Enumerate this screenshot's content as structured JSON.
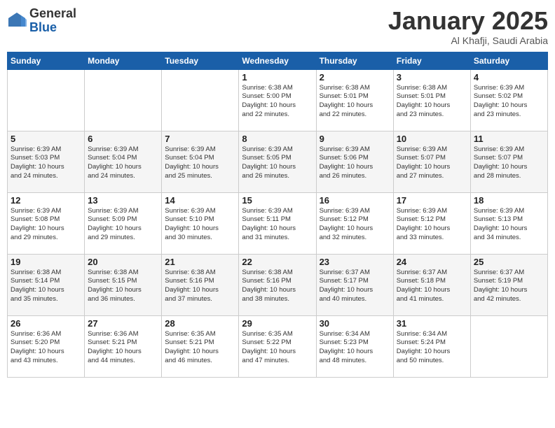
{
  "header": {
    "logo_general": "General",
    "logo_blue": "Blue",
    "month": "January 2025",
    "location": "Al Khafji, Saudi Arabia"
  },
  "days_of_week": [
    "Sunday",
    "Monday",
    "Tuesday",
    "Wednesday",
    "Thursday",
    "Friday",
    "Saturday"
  ],
  "weeks": [
    [
      {
        "day": "",
        "info": ""
      },
      {
        "day": "",
        "info": ""
      },
      {
        "day": "",
        "info": ""
      },
      {
        "day": "1",
        "info": "Sunrise: 6:38 AM\nSunset: 5:00 PM\nDaylight: 10 hours\nand 22 minutes."
      },
      {
        "day": "2",
        "info": "Sunrise: 6:38 AM\nSunset: 5:01 PM\nDaylight: 10 hours\nand 22 minutes."
      },
      {
        "day": "3",
        "info": "Sunrise: 6:38 AM\nSunset: 5:01 PM\nDaylight: 10 hours\nand 23 minutes."
      },
      {
        "day": "4",
        "info": "Sunrise: 6:39 AM\nSunset: 5:02 PM\nDaylight: 10 hours\nand 23 minutes."
      }
    ],
    [
      {
        "day": "5",
        "info": "Sunrise: 6:39 AM\nSunset: 5:03 PM\nDaylight: 10 hours\nand 24 minutes."
      },
      {
        "day": "6",
        "info": "Sunrise: 6:39 AM\nSunset: 5:04 PM\nDaylight: 10 hours\nand 24 minutes."
      },
      {
        "day": "7",
        "info": "Sunrise: 6:39 AM\nSunset: 5:04 PM\nDaylight: 10 hours\nand 25 minutes."
      },
      {
        "day": "8",
        "info": "Sunrise: 6:39 AM\nSunset: 5:05 PM\nDaylight: 10 hours\nand 26 minutes."
      },
      {
        "day": "9",
        "info": "Sunrise: 6:39 AM\nSunset: 5:06 PM\nDaylight: 10 hours\nand 26 minutes."
      },
      {
        "day": "10",
        "info": "Sunrise: 6:39 AM\nSunset: 5:07 PM\nDaylight: 10 hours\nand 27 minutes."
      },
      {
        "day": "11",
        "info": "Sunrise: 6:39 AM\nSunset: 5:07 PM\nDaylight: 10 hours\nand 28 minutes."
      }
    ],
    [
      {
        "day": "12",
        "info": "Sunrise: 6:39 AM\nSunset: 5:08 PM\nDaylight: 10 hours\nand 29 minutes."
      },
      {
        "day": "13",
        "info": "Sunrise: 6:39 AM\nSunset: 5:09 PM\nDaylight: 10 hours\nand 29 minutes."
      },
      {
        "day": "14",
        "info": "Sunrise: 6:39 AM\nSunset: 5:10 PM\nDaylight: 10 hours\nand 30 minutes."
      },
      {
        "day": "15",
        "info": "Sunrise: 6:39 AM\nSunset: 5:11 PM\nDaylight: 10 hours\nand 31 minutes."
      },
      {
        "day": "16",
        "info": "Sunrise: 6:39 AM\nSunset: 5:12 PM\nDaylight: 10 hours\nand 32 minutes."
      },
      {
        "day": "17",
        "info": "Sunrise: 6:39 AM\nSunset: 5:12 PM\nDaylight: 10 hours\nand 33 minutes."
      },
      {
        "day": "18",
        "info": "Sunrise: 6:39 AM\nSunset: 5:13 PM\nDaylight: 10 hours\nand 34 minutes."
      }
    ],
    [
      {
        "day": "19",
        "info": "Sunrise: 6:38 AM\nSunset: 5:14 PM\nDaylight: 10 hours\nand 35 minutes."
      },
      {
        "day": "20",
        "info": "Sunrise: 6:38 AM\nSunset: 5:15 PM\nDaylight: 10 hours\nand 36 minutes."
      },
      {
        "day": "21",
        "info": "Sunrise: 6:38 AM\nSunset: 5:16 PM\nDaylight: 10 hours\nand 37 minutes."
      },
      {
        "day": "22",
        "info": "Sunrise: 6:38 AM\nSunset: 5:16 PM\nDaylight: 10 hours\nand 38 minutes."
      },
      {
        "day": "23",
        "info": "Sunrise: 6:37 AM\nSunset: 5:17 PM\nDaylight: 10 hours\nand 40 minutes."
      },
      {
        "day": "24",
        "info": "Sunrise: 6:37 AM\nSunset: 5:18 PM\nDaylight: 10 hours\nand 41 minutes."
      },
      {
        "day": "25",
        "info": "Sunrise: 6:37 AM\nSunset: 5:19 PM\nDaylight: 10 hours\nand 42 minutes."
      }
    ],
    [
      {
        "day": "26",
        "info": "Sunrise: 6:36 AM\nSunset: 5:20 PM\nDaylight: 10 hours\nand 43 minutes."
      },
      {
        "day": "27",
        "info": "Sunrise: 6:36 AM\nSunset: 5:21 PM\nDaylight: 10 hours\nand 44 minutes."
      },
      {
        "day": "28",
        "info": "Sunrise: 6:35 AM\nSunset: 5:21 PM\nDaylight: 10 hours\nand 46 minutes."
      },
      {
        "day": "29",
        "info": "Sunrise: 6:35 AM\nSunset: 5:22 PM\nDaylight: 10 hours\nand 47 minutes."
      },
      {
        "day": "30",
        "info": "Sunrise: 6:34 AM\nSunset: 5:23 PM\nDaylight: 10 hours\nand 48 minutes."
      },
      {
        "day": "31",
        "info": "Sunrise: 6:34 AM\nSunset: 5:24 PM\nDaylight: 10 hours\nand 50 minutes."
      },
      {
        "day": "",
        "info": ""
      }
    ]
  ]
}
